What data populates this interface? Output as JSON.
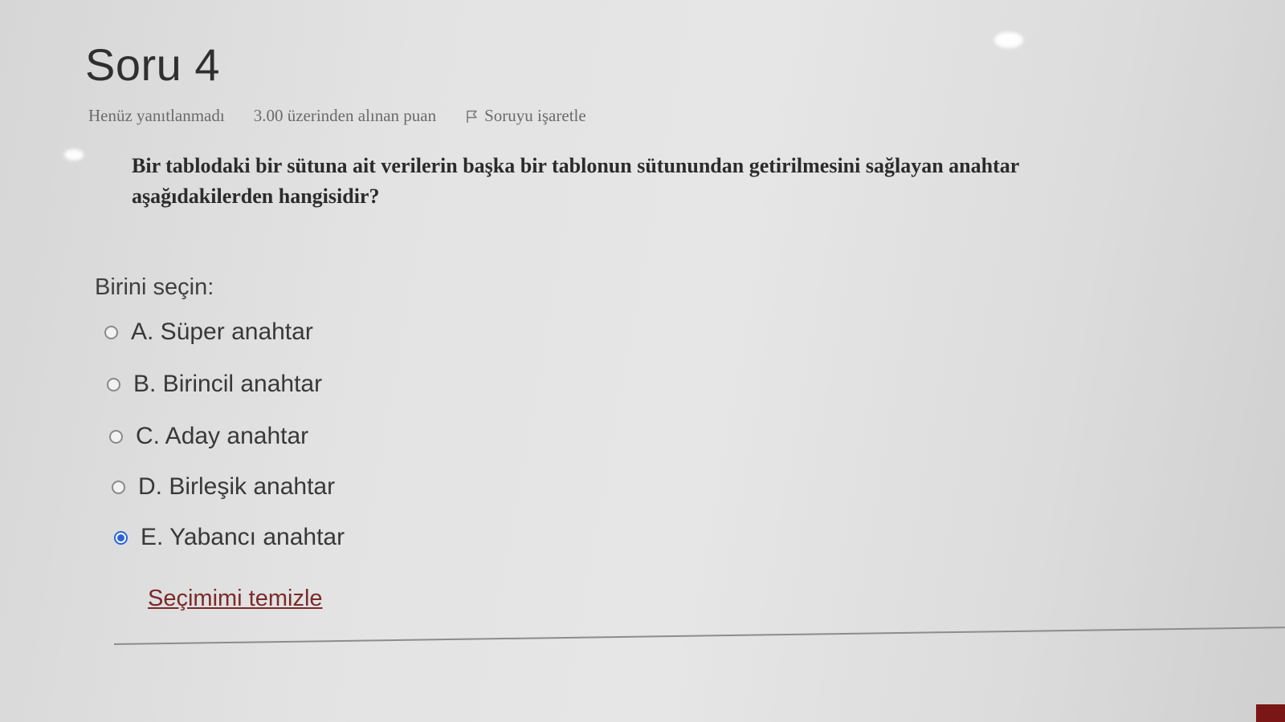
{
  "question": {
    "title": "Soru 4",
    "state": "Henüz yanıtlanmadı",
    "grade": "3.00 üzerinden alınan puan",
    "flag_label": "Soruyu işaretle",
    "text": "Bir tablodaki bir sütuna ait verilerin başka bir tablonun sütunundan getirilmesini sağlayan anahtar aşağıdakilerden hangisidir?"
  },
  "answer_block": {
    "prompt": "Birini seçin:",
    "options": [
      {
        "label": "A. Süper anahtar",
        "selected": false
      },
      {
        "label": "B. Birincil anahtar",
        "selected": false
      },
      {
        "label": "C. Aday anahtar",
        "selected": false
      },
      {
        "label": "D. Birleşik anahtar",
        "selected": false
      },
      {
        "label": "E. Yabancı anahtar",
        "selected": true
      }
    ],
    "clear_label": "Seçimimi temizle"
  },
  "colors": {
    "radio_selected": "#2a63d6",
    "link": "#7b2a2a",
    "accent_block": "#7a1616"
  }
}
